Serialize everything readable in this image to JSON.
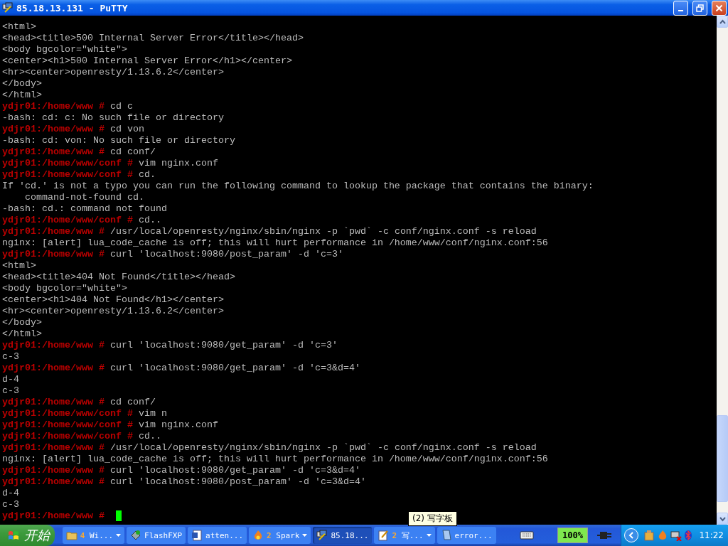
{
  "window": {
    "title": "85.18.13.131 - PuTTY"
  },
  "terminal": {
    "lines": [
      {
        "text": "<html>"
      },
      {
        "text": "<head><title>500 Internal Server Error</title></head>"
      },
      {
        "text": "<body bgcolor=\"white\">"
      },
      {
        "text": "<center><h1>500 Internal Server Error</h1></center>"
      },
      {
        "text": "<hr><center>openresty/1.13.6.2</center>"
      },
      {
        "text": "</body>"
      },
      {
        "text": "</html>"
      },
      {
        "prompt": "ydjr01:/home/www #",
        "text": "cd c"
      },
      {
        "text": "-bash: cd: c: No such file or directory"
      },
      {
        "prompt": "ydjr01:/home/www #",
        "text": "cd von"
      },
      {
        "text": "-bash: cd: von: No such file or directory"
      },
      {
        "prompt": "ydjr01:/home/www #",
        "text": "cd conf/"
      },
      {
        "prompt": "ydjr01:/home/www/conf #",
        "text": "vim nginx.conf"
      },
      {
        "prompt": "ydjr01:/home/www/conf #",
        "text": "cd."
      },
      {
        "text": "If 'cd.' is not a typo you can run the following command to lookup the package that contains the binary:"
      },
      {
        "text": "    command-not-found cd."
      },
      {
        "text": "-bash: cd.: command not found"
      },
      {
        "prompt": "ydjr01:/home/www/conf #",
        "text": "cd.."
      },
      {
        "prompt": "ydjr01:/home/www #",
        "text": "/usr/local/openresty/nginx/sbin/nginx -p `pwd` -c conf/nginx.conf -s reload"
      },
      {
        "text": "nginx: [alert] lua_code_cache is off; this will hurt performance in /home/www/conf/nginx.conf:56"
      },
      {
        "prompt": "ydjr01:/home/www #",
        "text": "curl 'localhost:9080/post_param' -d 'c=3'"
      },
      {
        "text": "<html>"
      },
      {
        "text": "<head><title>404 Not Found</title></head>"
      },
      {
        "text": "<body bgcolor=\"white\">"
      },
      {
        "text": "<center><h1>404 Not Found</h1></center>"
      },
      {
        "text": "<hr><center>openresty/1.13.6.2</center>"
      },
      {
        "text": "</body>"
      },
      {
        "text": "</html>"
      },
      {
        "prompt": "ydjr01:/home/www #",
        "text": "curl 'localhost:9080/get_param' -d 'c=3'"
      },
      {
        "text": "c-3"
      },
      {
        "prompt": "ydjr01:/home/www #",
        "text": "curl 'localhost:9080/get_param' -d 'c=3&d=4'"
      },
      {
        "text": "d-4"
      },
      {
        "text": "c-3"
      },
      {
        "prompt": "ydjr01:/home/www #",
        "text": "cd conf/"
      },
      {
        "prompt": "ydjr01:/home/www/conf #",
        "text": "vim n"
      },
      {
        "prompt": "ydjr01:/home/www/conf #",
        "text": "vim nginx.conf"
      },
      {
        "prompt": "ydjr01:/home/www/conf #",
        "text": "cd.."
      },
      {
        "prompt": "ydjr01:/home/www #",
        "text": "/usr/local/openresty/nginx/sbin/nginx -p `pwd` -c conf/nginx.conf -s reload"
      },
      {
        "text": "nginx: [alert] lua_code_cache is off; this will hurt performance in /home/www/conf/nginx.conf:56"
      },
      {
        "prompt": "ydjr01:/home/www #",
        "text": "curl 'localhost:9080/get_param' -d 'c=3&d=4'"
      },
      {
        "prompt": "ydjr01:/home/www #",
        "text": "curl 'localhost:9080/post_param' -d 'c=3&d=4'"
      },
      {
        "text": "d-4"
      },
      {
        "text": "c-3"
      },
      {
        "prompt": "ydjr01:/home/www #",
        "cursor": true
      }
    ]
  },
  "tooltip": {
    "text": "(2) 写字板"
  },
  "taskbar": {
    "start_label": "开始",
    "tasks": [
      {
        "kind": "folder",
        "count": "4",
        "label": "Wi...",
        "grouped": true,
        "selected": false
      },
      {
        "kind": "ftp",
        "label": "FlashFXP",
        "grouped": false,
        "selected": false
      },
      {
        "kind": "word",
        "label": "atten...",
        "grouped": false,
        "selected": false
      },
      {
        "kind": "flame",
        "count": "2",
        "label": "Spark",
        "grouped": true,
        "selected": false
      },
      {
        "kind": "putty",
        "label": "85.18...",
        "grouped": false,
        "selected": true
      },
      {
        "kind": "pad",
        "count": "2",
        "label": "写...",
        "grouped": true,
        "selected": false
      },
      {
        "kind": "note",
        "label": "error...",
        "grouped": false,
        "selected": false
      }
    ],
    "battery": "100%",
    "clock": "11:22"
  }
}
